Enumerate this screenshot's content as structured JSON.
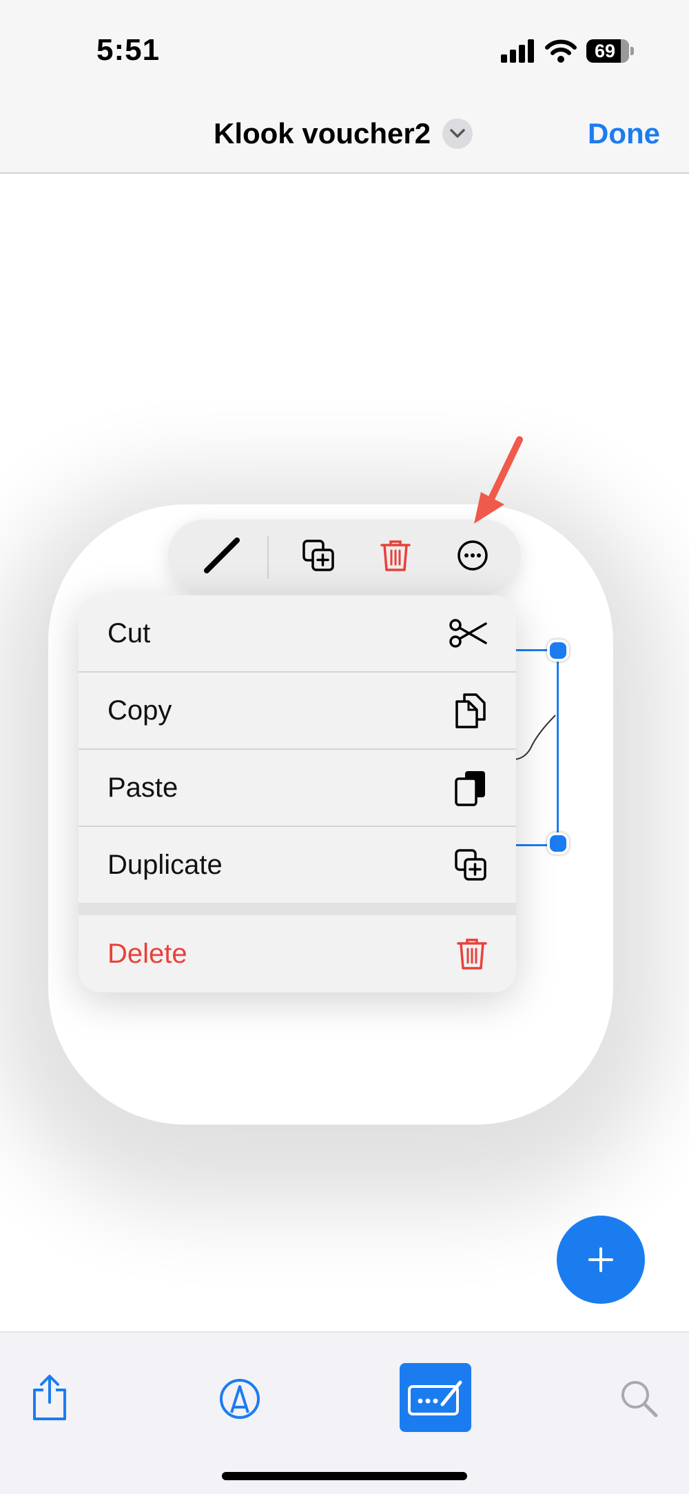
{
  "status_bar": {
    "time": "5:51",
    "battery_level": "69",
    "icons": [
      "cellular-signal-icon",
      "wifi-icon",
      "battery-icon"
    ]
  },
  "nav": {
    "title": "Klook voucher2",
    "title_menu_icon": "chevron-down-icon",
    "done_label": "Done"
  },
  "toolbar": {
    "items": [
      "pen-stroke-icon",
      "duplicate-icon",
      "trash-icon",
      "more-icon"
    ]
  },
  "menu": {
    "items": [
      {
        "label": "Cut",
        "icon": "scissors-icon"
      },
      {
        "label": "Copy",
        "icon": "copy-icon"
      },
      {
        "label": "Paste",
        "icon": "paste-icon"
      },
      {
        "label": "Duplicate",
        "icon": "duplicate-icon"
      },
      {
        "label": "Delete",
        "icon": "trash-icon",
        "destructive": true
      }
    ]
  },
  "fab": {
    "icon": "plus-icon"
  },
  "tabbar": {
    "items": [
      {
        "icon": "share-icon"
      },
      {
        "icon": "markup-icon"
      },
      {
        "icon": "signature-icon",
        "active": true
      },
      {
        "icon": "search-icon"
      }
    ]
  },
  "colors": {
    "accent": "#1b7cf0",
    "destructive": "#e8413a",
    "annotation_arrow": "#ef5a4b"
  }
}
